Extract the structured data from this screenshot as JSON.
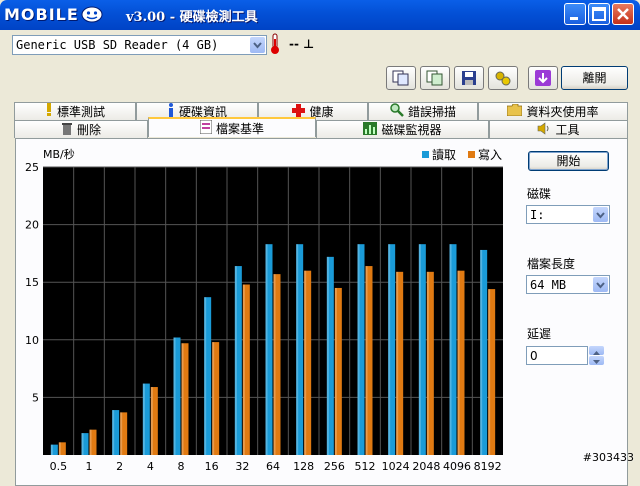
{
  "window": {
    "logo_text": "MOBILE",
    "title": "v3.00 - 硬碟檢測工具"
  },
  "toolbar": {
    "drive_combo_value": "Generic USB SD Reader (4 GB)",
    "temperature": "-- ⊥",
    "close_button": "離開"
  },
  "tabs_row1": [
    "標準測試",
    "硬碟資訊",
    "健康",
    "錯誤掃描",
    "資料夾使用率"
  ],
  "tabs_row2": [
    "刪除",
    "檔案基準",
    "磁碟監視器",
    "工具"
  ],
  "side": {
    "start_button": "開始",
    "drive_label": "磁碟",
    "drive_value": "I:",
    "file_length_label": "檔案長度",
    "file_length_value": "64 MB",
    "delay_label": "延遲",
    "delay_value": "0"
  },
  "watermark": "#303433",
  "colors": {
    "read": "#1A9BD8",
    "write": "#E07A12",
    "plot_bg": "#000000",
    "grid": "#555555"
  },
  "chart_data": {
    "type": "bar",
    "ylabel": "MB/秒",
    "ylim": [
      0,
      25
    ],
    "yticks": [
      5,
      10,
      15,
      20,
      25
    ],
    "categories": [
      "0.5",
      "1",
      "2",
      "4",
      "8",
      "16",
      "32",
      "64",
      "128",
      "256",
      "512",
      "1024",
      "2048",
      "4096",
      "8192"
    ],
    "series": [
      {
        "name": "讀取",
        "values": [
          0.9,
          1.9,
          3.9,
          6.2,
          10.2,
          13.7,
          16.4,
          18.3,
          18.3,
          17.2,
          18.3,
          18.3,
          18.3,
          18.3,
          17.8
        ]
      },
      {
        "name": "寫入",
        "values": [
          1.1,
          2.2,
          3.7,
          5.9,
          9.7,
          9.8,
          14.8,
          15.7,
          16.0,
          14.5,
          16.4,
          15.9,
          15.9,
          16.0,
          14.4
        ]
      }
    ]
  }
}
